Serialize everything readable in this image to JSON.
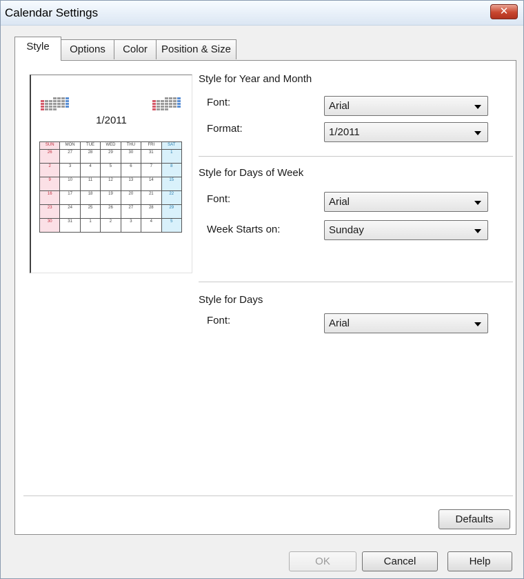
{
  "window": {
    "title": "Calendar Settings",
    "close_label": "✕"
  },
  "tabs": [
    {
      "label": "Style",
      "active": true
    },
    {
      "label": "Options",
      "active": false
    },
    {
      "label": "Color",
      "active": false
    },
    {
      "label": "Position & Size",
      "active": false
    }
  ],
  "preview": {
    "month_title": "1/2011",
    "weekdays": [
      "SUN",
      "MON",
      "TUE",
      "WED",
      "THU",
      "FRI",
      "SAT"
    ],
    "weeks": [
      [
        "26",
        "27",
        "28",
        "29",
        "30",
        "31",
        "1"
      ],
      [
        "2",
        "3",
        "4",
        "5",
        "6",
        "7",
        "8"
      ],
      [
        "9",
        "10",
        "11",
        "12",
        "13",
        "14",
        "15"
      ],
      [
        "16",
        "17",
        "18",
        "19",
        "20",
        "21",
        "22"
      ],
      [
        "23",
        "24",
        "25",
        "26",
        "27",
        "28",
        "29"
      ],
      [
        "30",
        "31",
        "1",
        "2",
        "3",
        "4",
        "5"
      ]
    ]
  },
  "year_month": {
    "title": "Style for Year and Month",
    "font_label": "Font:",
    "font_value": "Arial",
    "format_label": "Format:",
    "format_value": "1/2011"
  },
  "days_of_week": {
    "title": "Style for Days of Week",
    "font_label": "Font:",
    "font_value": "Arial",
    "week_starts_label": "Week Starts on:",
    "week_starts_value": "Sunday"
  },
  "days": {
    "title": "Style for Days",
    "font_label": "Font:",
    "font_value": "Arial"
  },
  "buttons": {
    "defaults": "Defaults",
    "ok": "OK",
    "cancel": "Cancel",
    "help": "Help"
  },
  "colors": {
    "sunday": "#fbe0e6",
    "saturday": "#d9f1fb",
    "close_button": "#c8462f"
  }
}
